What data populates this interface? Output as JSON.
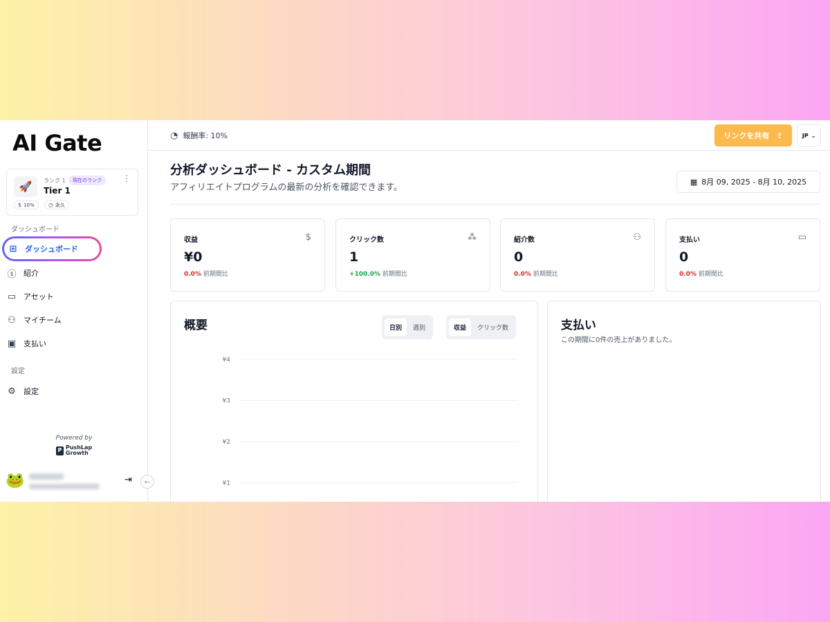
{
  "sidebar": {
    "logo": "AI Gate",
    "rank": {
      "label": "ランク 1",
      "badge": "現在のランク",
      "tier": "Tier 1",
      "chips": [
        {
          "icon": "dollar-circle-icon",
          "label": "10%"
        },
        {
          "icon": "clock-icon",
          "label": "永久"
        }
      ]
    },
    "section_dashboard": "ダッシュボード",
    "items": [
      {
        "label": "ダッシュボード",
        "icon": "grid-icon",
        "active": true
      },
      {
        "label": "紹介",
        "icon": "dollar-circle-icon"
      },
      {
        "label": "アセット",
        "icon": "folder-icon"
      },
      {
        "label": "マイチーム",
        "icon": "users-icon"
      },
      {
        "label": "支払い",
        "icon": "banknote-icon"
      }
    ],
    "section_settings": "設定",
    "settings_item": {
      "label": "設定",
      "icon": "gear-icon"
    },
    "powered_by": "Powered by",
    "powered_brand_line1": "PushLap",
    "powered_brand_line2": "Growth"
  },
  "topbar": {
    "rate": "報酬率: 10%",
    "share_label": "リンクを共有",
    "lang": "JP"
  },
  "header": {
    "title": "分析ダッシュボード - カスタム期間",
    "subtitle": "アフィリエイトプログラムの最新の分析を確認できます。",
    "date_range": "8月 09, 2025 - 8月 10, 2025"
  },
  "stats": [
    {
      "label": "収益",
      "icon": "dollar-icon",
      "value": "¥0",
      "change": "0.0%",
      "change_dir": "neg",
      "change_suffix": "前期間比"
    },
    {
      "label": "クリック数",
      "icon": "cursor-click-icon",
      "value": "1",
      "change": "+100.0%",
      "change_dir": "pos",
      "change_suffix": "前期間比"
    },
    {
      "label": "紹介数",
      "icon": "users-icon",
      "value": "0",
      "change": "0.0%",
      "change_dir": "neg",
      "change_suffix": "前期間比"
    },
    {
      "label": "支払い",
      "icon": "credit-card-icon",
      "value": "0",
      "change": "0.0%",
      "change_dir": "neg",
      "change_suffix": "前期間比"
    }
  ],
  "overview": {
    "title": "概要",
    "period_toggle": [
      "日別",
      "週別"
    ],
    "metric_toggle": [
      "収益",
      "クリック数"
    ]
  },
  "chart_data": {
    "type": "line",
    "y_ticks": [
      "¥4",
      "¥3",
      "¥2",
      "¥1"
    ],
    "ylim": [
      0,
      4
    ],
    "grid": true,
    "series": []
  },
  "payouts": {
    "title": "支払い",
    "subtitle": "この期間に0件の売上がありました。"
  }
}
